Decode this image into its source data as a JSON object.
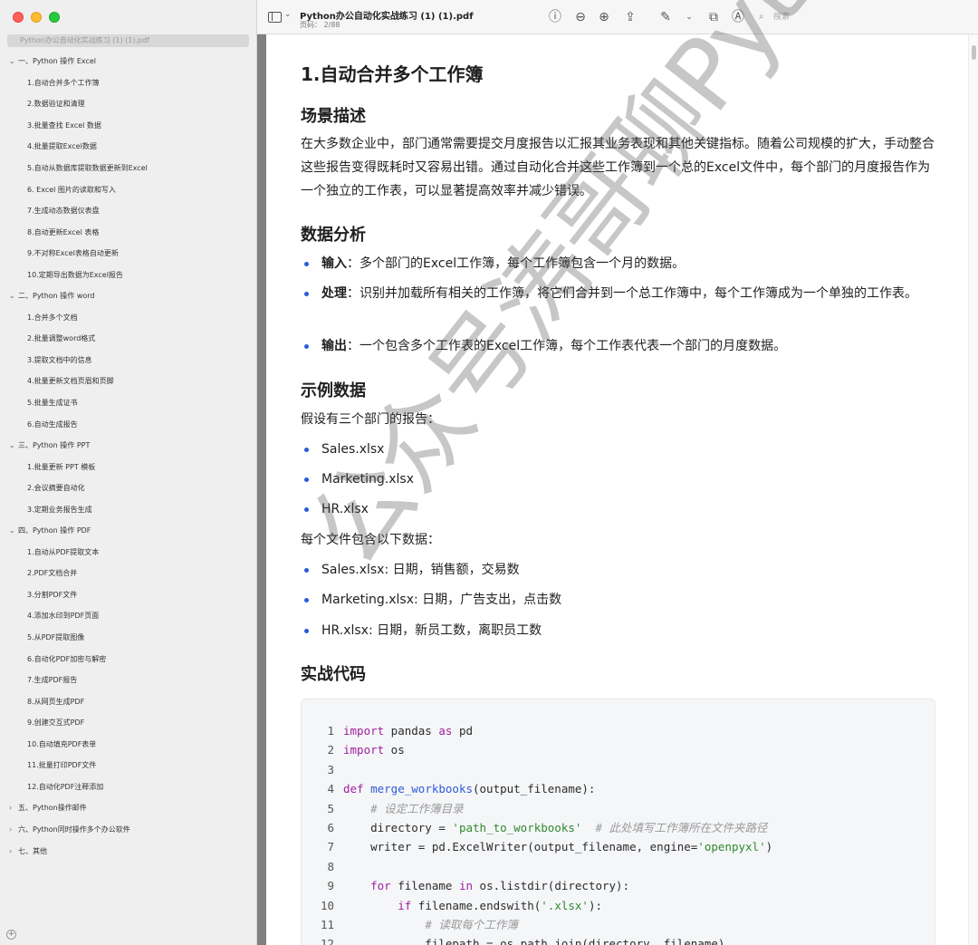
{
  "window": {
    "doc_title": "Python办公自动化实战练习 (1) (1).pdf",
    "page_indicator": "页码： 2/88",
    "search_placeholder": "搜索"
  },
  "sidebar": {
    "file_name": "Python办公自动化实战练习 (1) (1).pdf",
    "items": [
      {
        "label": "一、Python 操作 Excel",
        "level": 0,
        "chevron": "⌄"
      },
      {
        "label": "1.自动合并多个工作簿",
        "level": 1
      },
      {
        "label": "2.数据验证和清理",
        "level": 1
      },
      {
        "label": "3.批量查找 Excel 数据",
        "level": 1
      },
      {
        "label": "4.批量提取Excel数据",
        "level": 1
      },
      {
        "label": "5.自动从数据库提取数据更新到Excel",
        "level": 1
      },
      {
        "label": "6. Excel 图片的读取和写入",
        "level": 1
      },
      {
        "label": "7.生成动态数据仪表盘",
        "level": 1
      },
      {
        "label": "8.自动更新Excel 表格",
        "level": 1
      },
      {
        "label": "9.不对称Excel表格自动更新",
        "level": 1
      },
      {
        "label": "10.定期导出数据为Excel报告",
        "level": 1
      },
      {
        "label": "二、Python 操作 word",
        "level": 0,
        "chevron": "⌄"
      },
      {
        "label": "1.合并多个文档",
        "level": 1
      },
      {
        "label": "2.批量调整word格式",
        "level": 1
      },
      {
        "label": "3.提取文档中的信息",
        "level": 1
      },
      {
        "label": "4.批量更新文档页眉和页脚",
        "level": 1
      },
      {
        "label": "5.批量生成证书",
        "level": 1
      },
      {
        "label": "6.自动生成报告",
        "level": 1
      },
      {
        "label": "三、Python 操作 PPT",
        "level": 0,
        "chevron": "⌄"
      },
      {
        "label": "1.批量更新 PPT 模板",
        "level": 1
      },
      {
        "label": "2.会议摘要自动化",
        "level": 1
      },
      {
        "label": "3.定期业务报告生成",
        "level": 1
      },
      {
        "label": "四、Python 操作 PDF",
        "level": 0,
        "chevron": "⌄"
      },
      {
        "label": "1.自动从PDF提取文本",
        "level": 1
      },
      {
        "label": "2.PDF文档合并",
        "level": 1
      },
      {
        "label": "3.分割PDF文件",
        "level": 1
      },
      {
        "label": "4.添加水印到PDF页面",
        "level": 1
      },
      {
        "label": "5.从PDF提取图像",
        "level": 1
      },
      {
        "label": "6.自动化PDF加密与解密",
        "level": 1
      },
      {
        "label": "7.生成PDF报告",
        "level": 1
      },
      {
        "label": "8.从网页生成PDF",
        "level": 1
      },
      {
        "label": "9.创建交互式PDF",
        "level": 1
      },
      {
        "label": "10.自动填充PDF表单",
        "level": 1
      },
      {
        "label": "11.批量打印PDF文件",
        "level": 1
      },
      {
        "label": "12.自动化PDF注释添加",
        "level": 1
      },
      {
        "label": "五、Python操作邮件",
        "level": 0,
        "chevron": "›"
      },
      {
        "label": "六、Python同时操作多个办公软件",
        "level": 0,
        "chevron": "›"
      },
      {
        "label": "七、其他",
        "level": 0,
        "chevron": "›"
      }
    ]
  },
  "page": {
    "title": "1.自动合并多个工作簿",
    "s1_heading": "场景描述",
    "s1_para": "在大多数企业中，部门通常需要提交月度报告以汇报其业务表现和其他关键指标。随着公司规模的扩大，手动整合这些报告变得既耗时又容易出错。通过自动化合并这些工作簿到一个总的Excel文件中，每个部门的月度报告作为一个独立的工作表，可以显著提高效率并减少错误。",
    "s2_heading": "数据分析",
    "b1_label": "输入",
    "b1_text": "：多个部门的Excel工作簿，每个工作簿包含一个月的数据。",
    "b2_label": "处理",
    "b2_text": "：识别并加载所有相关的工作簿，将它们合并到一个总工作簿中，每个工作簿成为一个单独的工作表。",
    "b3_label": "输出",
    "b3_text": "：一个包含多个工作表的Excel工作簿，每个工作表代表一个部门的月度数据。",
    "s3_heading": "示例数据",
    "s3_intro": "假设有三个部门的报告：",
    "files": [
      "Sales.xlsx",
      "Marketing.xlsx",
      "HR.xlsx"
    ],
    "s3_intro2": "每个文件包含以下数据：",
    "file_fields": [
      "Sales.xlsx: 日期，销售额，交易数",
      "Marketing.xlsx: 日期，广告支出，点击数",
      "HR.xlsx: 日期，新员工数，离职员工数"
    ],
    "s4_heading": "实战代码",
    "code": [
      {
        "n": "1",
        "parts": [
          [
            "kw",
            "import"
          ],
          [
            "",
            " pandas "
          ],
          [
            "kw",
            "as"
          ],
          [
            "",
            " pd"
          ]
        ]
      },
      {
        "n": "2",
        "parts": [
          [
            "kw",
            "import"
          ],
          [
            "",
            " os"
          ]
        ]
      },
      {
        "n": "3",
        "parts": []
      },
      {
        "n": "4",
        "parts": [
          [
            "kw",
            "def"
          ],
          [
            "",
            " "
          ],
          [
            "fn",
            "merge_workbooks"
          ],
          [
            "",
            "(output_filename):"
          ]
        ]
      },
      {
        "n": "5",
        "parts": [
          [
            "",
            "    "
          ],
          [
            "cm",
            "# 设定工作簿目录"
          ]
        ]
      },
      {
        "n": "6",
        "parts": [
          [
            "",
            "    directory = "
          ],
          [
            "st",
            "'path_to_workbooks'"
          ],
          [
            "",
            "  "
          ],
          [
            "cm",
            "# 此处填写工作簿所在文件夹路径"
          ]
        ]
      },
      {
        "n": "7",
        "parts": [
          [
            "",
            "    writer = pd.ExcelWriter(output_filename, engine="
          ],
          [
            "st",
            "'openpyxl'"
          ],
          [
            "",
            ")"
          ]
        ]
      },
      {
        "n": "8",
        "parts": []
      },
      {
        "n": "9",
        "parts": [
          [
            "",
            "    "
          ],
          [
            "kw",
            "for"
          ],
          [
            "",
            " filename "
          ],
          [
            "kw",
            "in"
          ],
          [
            "",
            " os.listdir(directory):"
          ]
        ]
      },
      {
        "n": "10",
        "parts": [
          [
            "",
            "        "
          ],
          [
            "kw",
            "if"
          ],
          [
            "",
            " filename.endswith("
          ],
          [
            "st",
            "'.xlsx'"
          ],
          [
            "",
            "):"
          ]
        ]
      },
      {
        "n": "11",
        "parts": [
          [
            "",
            "            "
          ],
          [
            "cm",
            "# 读取每个工作簿"
          ]
        ]
      },
      {
        "n": "12",
        "parts": [
          [
            "",
            "            filepath = os.path.join(directory, filename)"
          ]
        ]
      }
    ]
  },
  "watermark": "公众号涛哥聊Python"
}
